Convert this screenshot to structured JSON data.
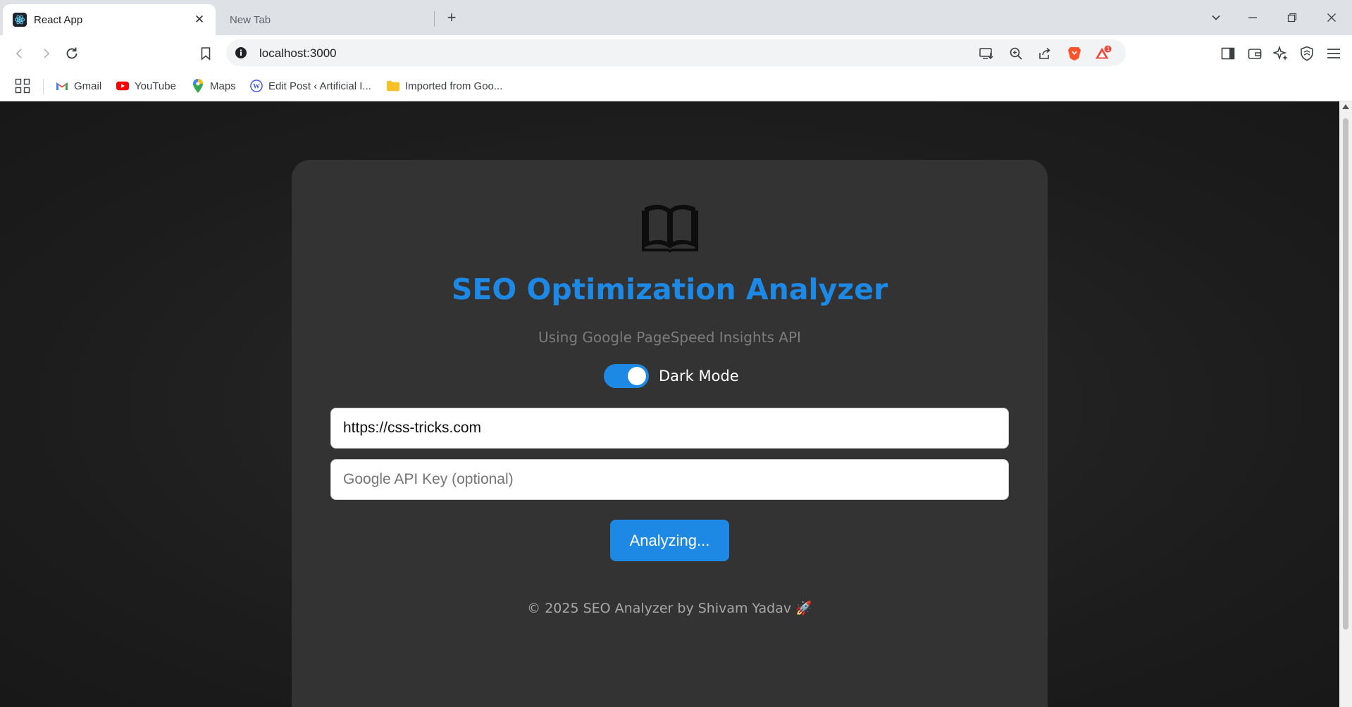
{
  "browser": {
    "tabs": [
      {
        "title": "React App",
        "active": true
      },
      {
        "title": "New Tab",
        "active": false
      }
    ],
    "address": "localhost:3000",
    "brave_badge": "1",
    "bookmarks": [
      {
        "label": "Gmail"
      },
      {
        "label": "YouTube"
      },
      {
        "label": "Maps"
      },
      {
        "label": "Edit Post ‹ Artificial I..."
      },
      {
        "label": "Imported from Goo..."
      }
    ]
  },
  "app": {
    "title": "SEO Optimization Analyzer",
    "subtitle": "Using Google PageSpeed Insights API",
    "dark_mode": {
      "label": "Dark Mode",
      "enabled": true
    },
    "url_input": {
      "value": "https://css-tricks.com"
    },
    "api_key_input": {
      "value": "",
      "placeholder": "Google API Key (optional)"
    },
    "analyze_button": "Analyzing...",
    "footer": "© 2025 SEO Analyzer by Shivam Yadav 🚀"
  },
  "colors": {
    "accent": "#1e88e5",
    "card": "#333333",
    "page_background": "#1e1e1e"
  }
}
